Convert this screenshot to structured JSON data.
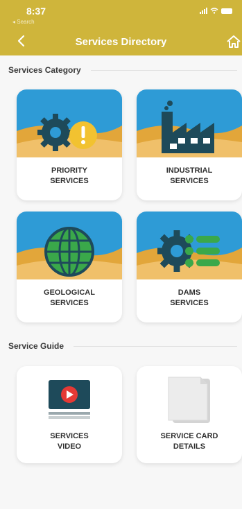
{
  "status": {
    "time": "8:37",
    "back_label": "◂ Search"
  },
  "header": {
    "title": "Services Directory"
  },
  "sections": {
    "category_label": "Services Category",
    "guide_label": "Service Guide"
  },
  "cards": {
    "priority": {
      "line1": "PRIORITY",
      "line2": "SERVICES"
    },
    "industrial": {
      "line1": "INDUSTRIAL",
      "line2": "SERVICES"
    },
    "geological": {
      "line1": "GEOLOGICAL",
      "line2": "SERVICES"
    },
    "dams": {
      "line1": "DAMS",
      "line2": "SERVICES"
    },
    "video": {
      "line1": "SERVICES",
      "line2": "VIDEO"
    },
    "service_card": {
      "line1": "SERVICE CARD",
      "line2": "DETAILS"
    }
  },
  "colors": {
    "header": "#cfb53b",
    "sky": "#2e9bd6",
    "sand": "#e2a63a",
    "icon_dark": "#1e4a5a",
    "icon_green": "#3aa84a",
    "alert_yellow": "#f2c230",
    "video_red": "#e53935"
  }
}
